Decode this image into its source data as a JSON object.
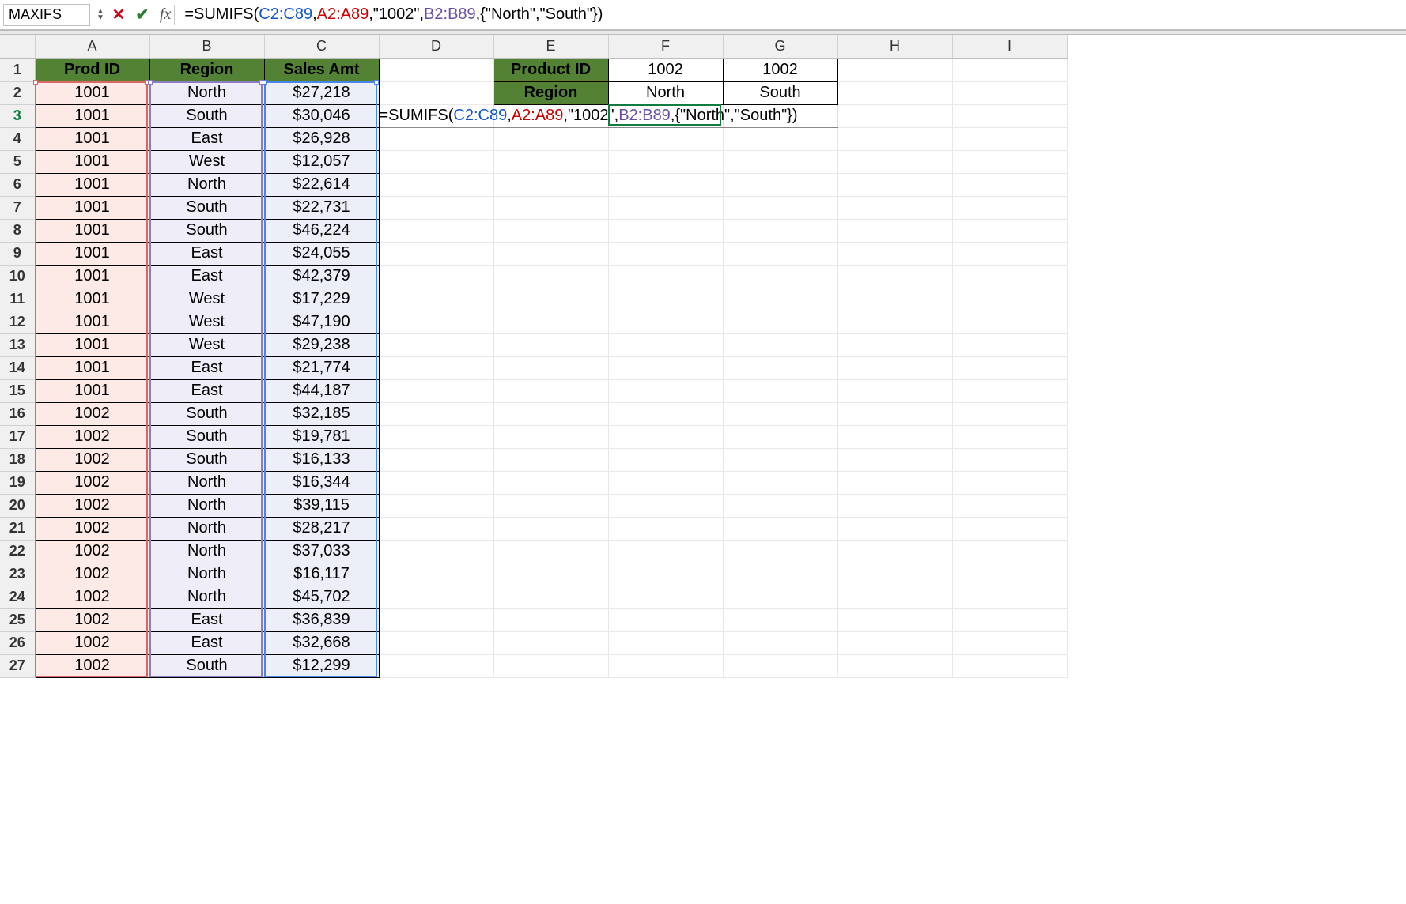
{
  "nameBox": "MAXIFS",
  "formula": {
    "prefix": "=SUMIFS(",
    "r1": "C2:C89",
    "c1": ",",
    "r2": "A2:A89",
    "c2": ",\"1002\",",
    "r3": "B2:B89",
    "suffix": ",{\"North\",\"South\"})"
  },
  "inlineFormula": {
    "prefix": "=SUMIFS(",
    "r1": "C2:C89",
    "c1": ",",
    "r2": "A2:A89",
    "c2": ",\"1002\",",
    "r3": "B2:B89",
    "suffix": ",{\"North\",\"South\"})"
  },
  "columns": [
    "A",
    "B",
    "C",
    "D",
    "E",
    "F",
    "G",
    "H",
    "I"
  ],
  "headersMain": {
    "A": "Prod ID",
    "B": "Region",
    "C": "Sales Amt"
  },
  "sideTable": {
    "r1": {
      "E": "Product ID",
      "F": "1002",
      "G": "1002"
    },
    "r2": {
      "E": "Region",
      "F": "North",
      "G": "South"
    }
  },
  "rows": [
    {
      "A": "1001",
      "B": "North",
      "C": "$27,218"
    },
    {
      "A": "1001",
      "B": "South",
      "C": "$30,046"
    },
    {
      "A": "1001",
      "B": "East",
      "C": "$26,928"
    },
    {
      "A": "1001",
      "B": "West",
      "C": "$12,057"
    },
    {
      "A": "1001",
      "B": "North",
      "C": "$22,614"
    },
    {
      "A": "1001",
      "B": "South",
      "C": "$22,731"
    },
    {
      "A": "1001",
      "B": "South",
      "C": "$46,224"
    },
    {
      "A": "1001",
      "B": "East",
      "C": "$24,055"
    },
    {
      "A": "1001",
      "B": "East",
      "C": "$42,379"
    },
    {
      "A": "1001",
      "B": "West",
      "C": "$17,229"
    },
    {
      "A": "1001",
      "B": "West",
      "C": "$47,190"
    },
    {
      "A": "1001",
      "B": "West",
      "C": "$29,238"
    },
    {
      "A": "1001",
      "B": "East",
      "C": "$21,774"
    },
    {
      "A": "1001",
      "B": "East",
      "C": "$44,187"
    },
    {
      "A": "1002",
      "B": "South",
      "C": "$32,185"
    },
    {
      "A": "1002",
      "B": "South",
      "C": "$19,781"
    },
    {
      "A": "1002",
      "B": "South",
      "C": "$16,133"
    },
    {
      "A": "1002",
      "B": "North",
      "C": "$16,344"
    },
    {
      "A": "1002",
      "B": "North",
      "C": "$39,115"
    },
    {
      "A": "1002",
      "B": "North",
      "C": "$28,217"
    },
    {
      "A": "1002",
      "B": "North",
      "C": "$37,033"
    },
    {
      "A": "1002",
      "B": "North",
      "C": "$16,117"
    },
    {
      "A": "1002",
      "B": "North",
      "C": "$45,702"
    },
    {
      "A": "1002",
      "B": "East",
      "C": "$36,839"
    },
    {
      "A": "1002",
      "B": "East",
      "C": "$32,668"
    },
    {
      "A": "1002",
      "B": "South",
      "C": "$12,299"
    }
  ],
  "numDataRows": 26,
  "colors": {
    "rangeA": "#e06666",
    "rangeB": "#8e7cc3",
    "rangeC": "#4a86e8"
  }
}
